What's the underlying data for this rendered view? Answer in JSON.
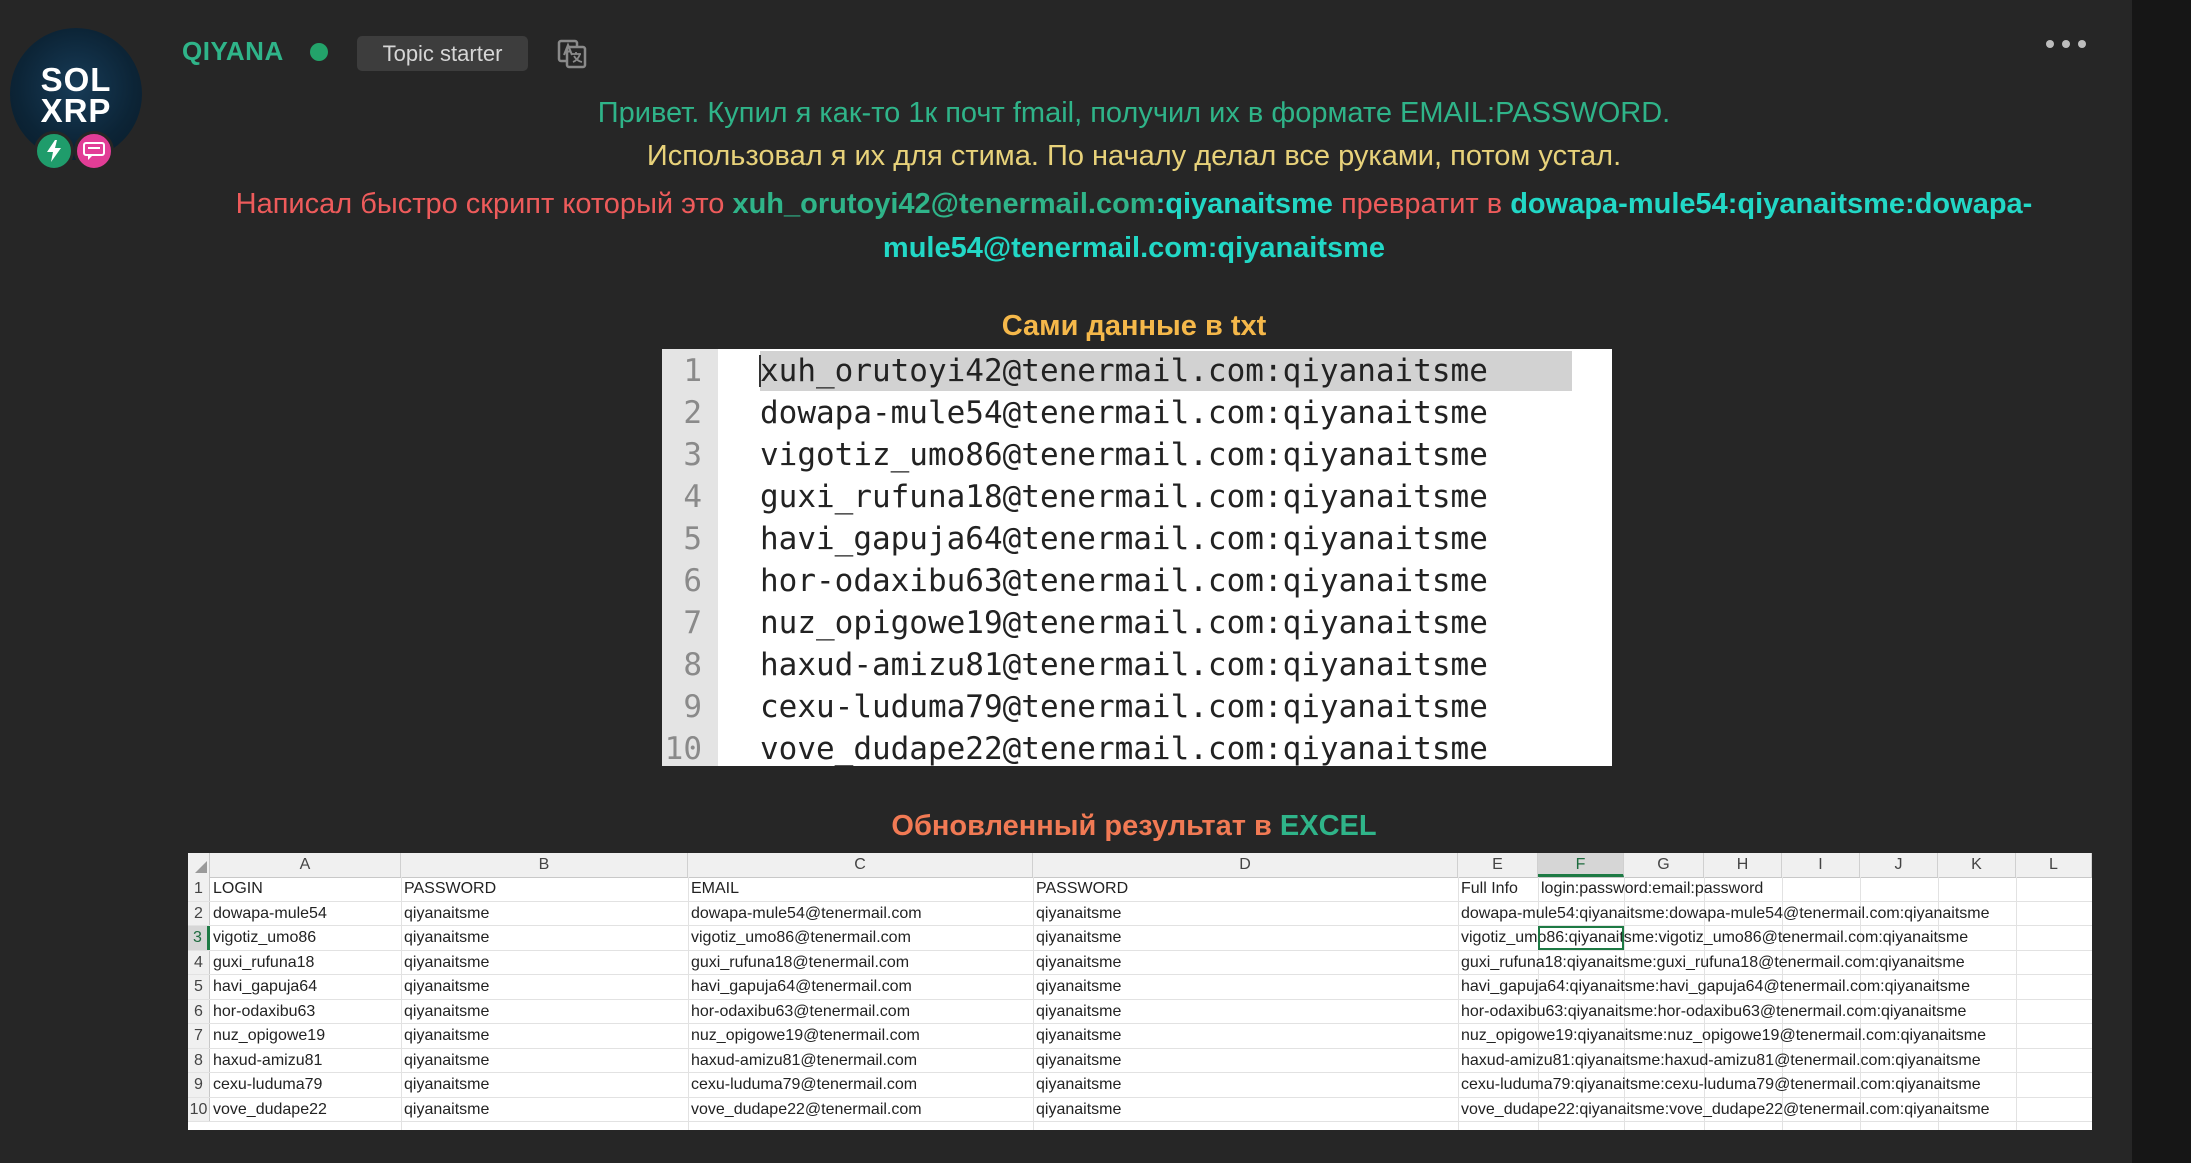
{
  "author": {
    "avatar_lines": [
      "SOL",
      "XRP"
    ],
    "username": "QIYANA",
    "status": "online",
    "topic_badge": "Topic starter",
    "badge_icons": [
      "bolt-icon",
      "chat-bubble-icon"
    ]
  },
  "actions": {
    "translate_icon": "translate-icon",
    "more_icon": "more-options-icon"
  },
  "message": {
    "line1": "Привет. Купил я как-то 1к почт fmail, получил их в формате EMAIL:PASSWORD.",
    "line2": "Использовал я их для стима. По началу делал все руками, потом устал.",
    "line3_prefix": "Написал быстро скрипт который это ",
    "line3_source_email": "xuh_orutoyi42@tenermail.com",
    "line3_source_pass": ":qiyanaitsme",
    "line3_mid": " превратит в ",
    "line3_result": "dowapa-mule54:qiyanaitsme:dowapa-mule54@tenermail.com:qiyanaitsme"
  },
  "txt_section": {
    "heading": "Сами данные в txt",
    "lines": [
      {
        "num": "1",
        "text": "xuh_orutoyi42@tenermail.com:qiyanaitsme"
      },
      {
        "num": "2",
        "text": "dowapa-mule54@tenermail.com:qiyanaitsme"
      },
      {
        "num": "3",
        "text": "vigotiz_umo86@tenermail.com:qiyanaitsme"
      },
      {
        "num": "4",
        "text": "guxi_rufuna18@tenermail.com:qiyanaitsme"
      },
      {
        "num": "5",
        "text": "havi_gapuja64@tenermail.com:qiyanaitsme"
      },
      {
        "num": "6",
        "text": "hor-odaxibu63@tenermail.com:qiyanaitsme"
      },
      {
        "num": "7",
        "text": "nuz_opigowe19@tenermail.com:qiyanaitsme"
      },
      {
        "num": "8",
        "text": "haxud-amizu81@tenermail.com:qiyanaitsme"
      },
      {
        "num": "9",
        "text": "cexu-luduma79@tenermail.com:qiyanaitsme"
      },
      {
        "num": "10",
        "text": "vove_dudape22@tenermail.com:qiyanaitsme"
      }
    ]
  },
  "excel_section": {
    "heading_prefix": "Обновленный результат в ",
    "heading_highlight": "EXCEL",
    "column_letters": [
      "A",
      "B",
      "C",
      "D",
      "E",
      "F",
      "G",
      "H",
      "I",
      "J",
      "K",
      "L"
    ],
    "header_row": {
      "num": "1",
      "login": "LOGIN",
      "password": "PASSWORD",
      "email": "EMAIL",
      "password2": "PASSWORD",
      "full_info": "Full Info",
      "format": "login:password:email:password"
    },
    "rows": [
      {
        "num": "2",
        "login": "dowapa-mule54",
        "password": "qiyanaitsme",
        "email": "dowapa-mule54@tenermail.com",
        "password2": "qiyanaitsme",
        "full": "dowapa-mule54:qiyanaitsme:dowapa-mule54@tenermail.com:qiyanaitsme"
      },
      {
        "num": "3",
        "login": "vigotiz_umo86",
        "password": "qiyanaitsme",
        "email": "vigotiz_umo86@tenermail.com",
        "password2": "qiyanaitsme",
        "full": "vigotiz_umo86:qiyanaitsme:vigotiz_umo86@tenermail.com:qiyanaitsme"
      },
      {
        "num": "4",
        "login": "guxi_rufuna18",
        "password": "qiyanaitsme",
        "email": "guxi_rufuna18@tenermail.com",
        "password2": "qiyanaitsme",
        "full": "guxi_rufuna18:qiyanaitsme:guxi_rufuna18@tenermail.com:qiyanaitsme"
      },
      {
        "num": "5",
        "login": "havi_gapuja64",
        "password": "qiyanaitsme",
        "email": "havi_gapuja64@tenermail.com",
        "password2": "qiyanaitsme",
        "full": "havi_gapuja64:qiyanaitsme:havi_gapuja64@tenermail.com:qiyanaitsme"
      },
      {
        "num": "6",
        "login": "hor-odaxibu63",
        "password": "qiyanaitsme",
        "email": "hor-odaxibu63@tenermail.com",
        "password2": "qiyanaitsme",
        "full": "hor-odaxibu63:qiyanaitsme:hor-odaxibu63@tenermail.com:qiyanaitsme"
      },
      {
        "num": "7",
        "login": "nuz_opigowe19",
        "password": "qiyanaitsme",
        "email": "nuz_opigowe19@tenermail.com",
        "password2": "qiyanaitsme",
        "full": "nuz_opigowe19:qiyanaitsme:nuz_opigowe19@tenermail.com:qiyanaitsme"
      },
      {
        "num": "8",
        "login": "haxud-amizu81",
        "password": "qiyanaitsme",
        "email": "haxud-amizu81@tenermail.com",
        "password2": "qiyanaitsme",
        "full": "haxud-amizu81:qiyanaitsme:haxud-amizu81@tenermail.com:qiyanaitsme"
      },
      {
        "num": "9",
        "login": "cexu-luduma79",
        "password": "qiyanaitsme",
        "email": "cexu-luduma79@tenermail.com",
        "password2": "qiyanaitsme",
        "full": "cexu-luduma79:qiyanaitsme:cexu-luduma79@tenermail.com:qiyanaitsme"
      },
      {
        "num": "10",
        "login": "vove_dudape22",
        "password": "qiyanaitsme",
        "email": "vove_dudape22@tenermail.com",
        "password2": "qiyanaitsme",
        "full": "vove_dudape22:qiyanaitsme:vove_dudape22@tenermail.com:qiyanaitsme"
      }
    ],
    "active_cell": "F3"
  }
}
